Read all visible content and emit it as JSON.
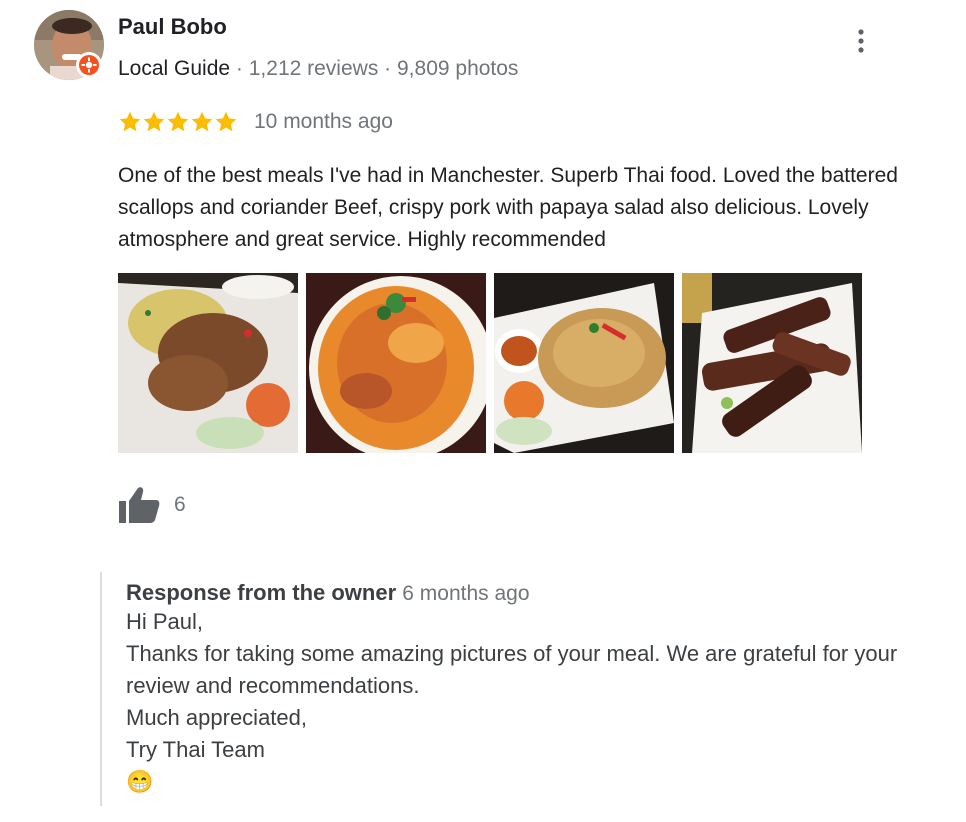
{
  "review": {
    "author": {
      "name": "Paul Bobo",
      "badge": "Local Guide",
      "reviews": "1,212 reviews",
      "photos": "9,809 photos",
      "separator": " · "
    },
    "rating": 5,
    "date": "10 months ago",
    "text": "One of the best meals I've had in Manchester. Superb Thai food. Loved the battered scallops and coriander Beef, crispy pork with papaya salad also delicious. Lovely atmosphere and great service. Highly recommended",
    "photos": [
      "papaya-salad-crispy-pork-photo",
      "battered-scallops-curry-photo",
      "thai-omelette-photo",
      "coriander-beef-photo"
    ],
    "likes": "6",
    "owner_response": {
      "title": "Response from the owner",
      "date": "6 months ago",
      "lines": [
        "Hi Paul,",
        "Thanks for taking some amazing pictures of your meal. We are grateful for your review and recommendations.",
        "Much appreciated,",
        "Try Thai Team"
      ],
      "emoji": "😁"
    }
  },
  "icons": {
    "more": "more-vert-icon",
    "like": "thumbs-up-icon",
    "star": "star-icon",
    "guide": "local-guide-badge-icon"
  },
  "colors": {
    "star": "#fbbc04",
    "guide_badge": "#f4511e",
    "muted_text": "#70757a",
    "like_icon": "#5f6368"
  }
}
